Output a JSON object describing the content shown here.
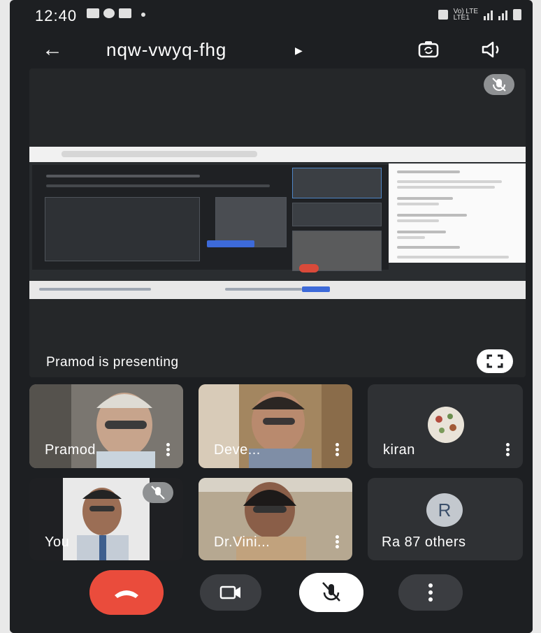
{
  "status_bar": {
    "time": "12:40",
    "network_label": "Vo) LTE\nLTE1"
  },
  "top_bar": {
    "meeting_code": "nqw-vwyq-fhg"
  },
  "presentation": {
    "presenting_text": "Pramod is presenting"
  },
  "participants": [
    {
      "label": "Pramod",
      "type": "video"
    },
    {
      "label": "Deve...",
      "type": "video"
    },
    {
      "label": "kiran",
      "type": "avatar-image"
    },
    {
      "label": "You",
      "type": "video-self"
    },
    {
      "label": "Dr.Vini...",
      "type": "video"
    },
    {
      "label": "Ra 87 others",
      "initial": "R",
      "type": "avatar-initial"
    }
  ],
  "controls": {
    "end_call": "phone-hangup-icon",
    "camera": "video-camera-icon",
    "mic": "mic-off-icon",
    "more": "more-vert-icon"
  },
  "colors": {
    "background": "#1d1f22",
    "end_call": "#ea4c3c",
    "tile": "#3a3c40"
  }
}
